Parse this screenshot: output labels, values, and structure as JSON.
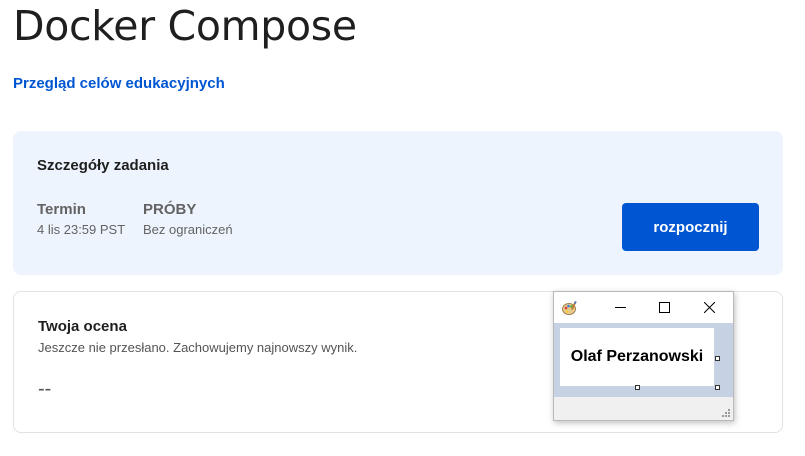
{
  "page": {
    "title": "Docker Compose",
    "overview_link": "Przegląd celów edukacyjnych"
  },
  "assignment": {
    "heading": "Szczegóły zadania",
    "deadline_label": "Termin",
    "deadline_value": "4 lis 23:59 PST",
    "attempts_label": "PRÓBY",
    "attempts_value": "Bez ograniczeń",
    "start_button": "rozpocznij",
    "accent_color": "#0056d2",
    "card_background": "#eef4fd"
  },
  "grade": {
    "heading": "Twoja ocena",
    "subtitle": "Jeszcze nie przesłano. Zachowujemy najnowszy wynik.",
    "value": "--"
  },
  "popup": {
    "icon": "paint-palette-icon",
    "minimize_icon": "minimize-icon",
    "maximize_icon": "maximize-icon",
    "close_icon": "close-icon",
    "label_text": "Olaf Perzanowski"
  }
}
